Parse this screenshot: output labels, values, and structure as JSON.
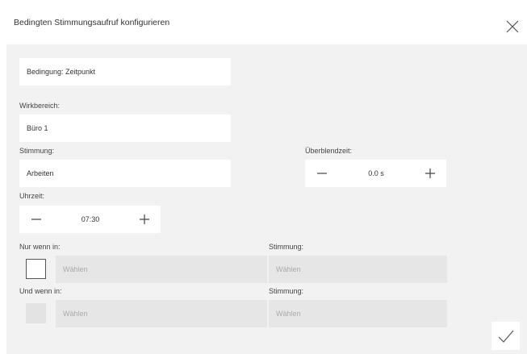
{
  "dialog": {
    "title": "Bedingten Stimmungsaufruf konfigurieren",
    "close_icon": "close-icon",
    "confirm_icon": "checkmark-icon"
  },
  "condition": {
    "value": "Bedingung: Zeitpunkt"
  },
  "scope": {
    "label": "Wirkbereich:",
    "value": "Büro 1"
  },
  "mood": {
    "label": "Stimmung:",
    "value": "Arbeiten"
  },
  "fade": {
    "label": "Überblendzeit:",
    "value": "0.0 s"
  },
  "time": {
    "label": "Uhrzeit:",
    "value": "07:30"
  },
  "only_if": {
    "label": "Nur wenn in:",
    "placeholder": "Wählen",
    "mood_label": "Stimmung:",
    "mood_placeholder": "Wählen"
  },
  "and_if": {
    "label": "Und wenn in:",
    "placeholder": "Wählen",
    "mood_label": "Stimmung:",
    "mood_placeholder": "Wählen"
  }
}
